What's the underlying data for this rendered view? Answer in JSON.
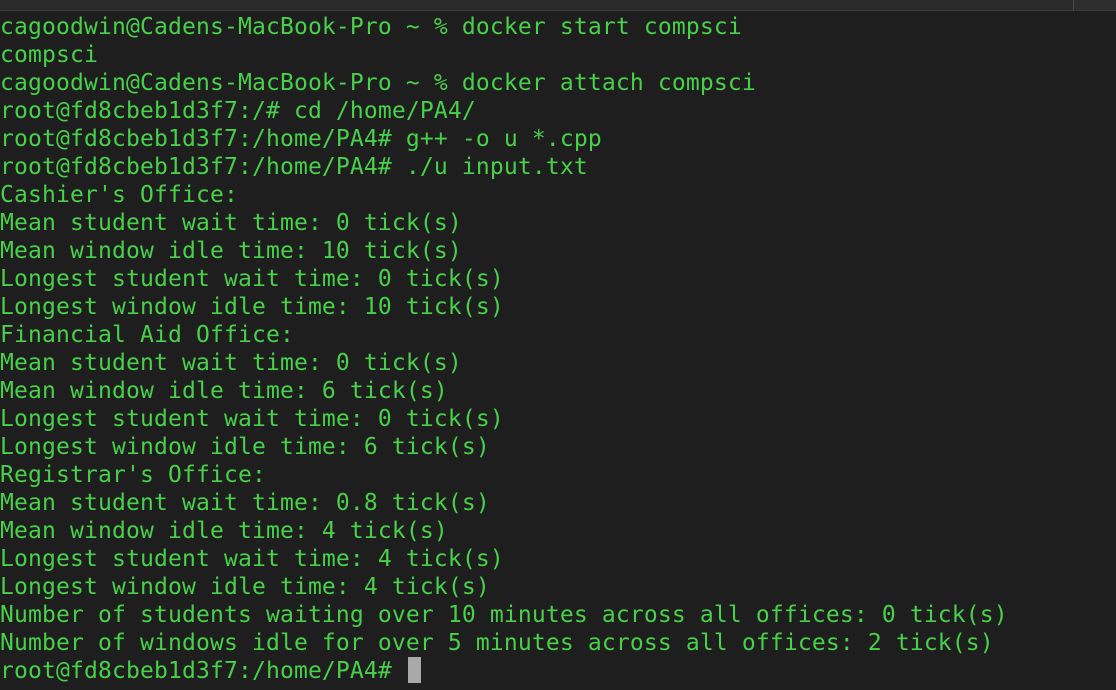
{
  "colors": {
    "background": "#1e1e1e",
    "text": "#48d04a",
    "cursor": "#a9a9a9"
  },
  "terminal": {
    "lines": [
      "cagoodwin@Cadens-MacBook-Pro ~ % docker start compsci",
      "compsci",
      "cagoodwin@Cadens-MacBook-Pro ~ % docker attach compsci",
      "root@fd8cbeb1d3f7:/# cd /home/PA4/",
      "root@fd8cbeb1d3f7:/home/PA4# g++ -o u *.cpp",
      "root@fd8cbeb1d3f7:/home/PA4# ./u input.txt",
      "Cashier's Office:",
      "Mean student wait time: 0 tick(s)",
      "Mean window idle time: 10 tick(s)",
      "Longest student wait time: 0 tick(s)",
      "Longest window idle time: 10 tick(s)",
      "Financial Aid Office:",
      "Mean student wait time: 0 tick(s)",
      "Mean window idle time: 6 tick(s)",
      "Longest student wait time: 0 tick(s)",
      "Longest window idle time: 6 tick(s)",
      "Registrar's Office:",
      "Mean student wait time: 0.8 tick(s)",
      "Mean window idle time: 4 tick(s)",
      "Longest student wait time: 4 tick(s)",
      "Longest window idle time: 4 tick(s)",
      "Number of students waiting over 10 minutes across all offices: 0 tick(s)",
      "Number of windows idle for over 5 minutes across all offices: 2 tick(s)"
    ],
    "prompt": "root@fd8cbeb1d3f7:/home/PA4# "
  }
}
